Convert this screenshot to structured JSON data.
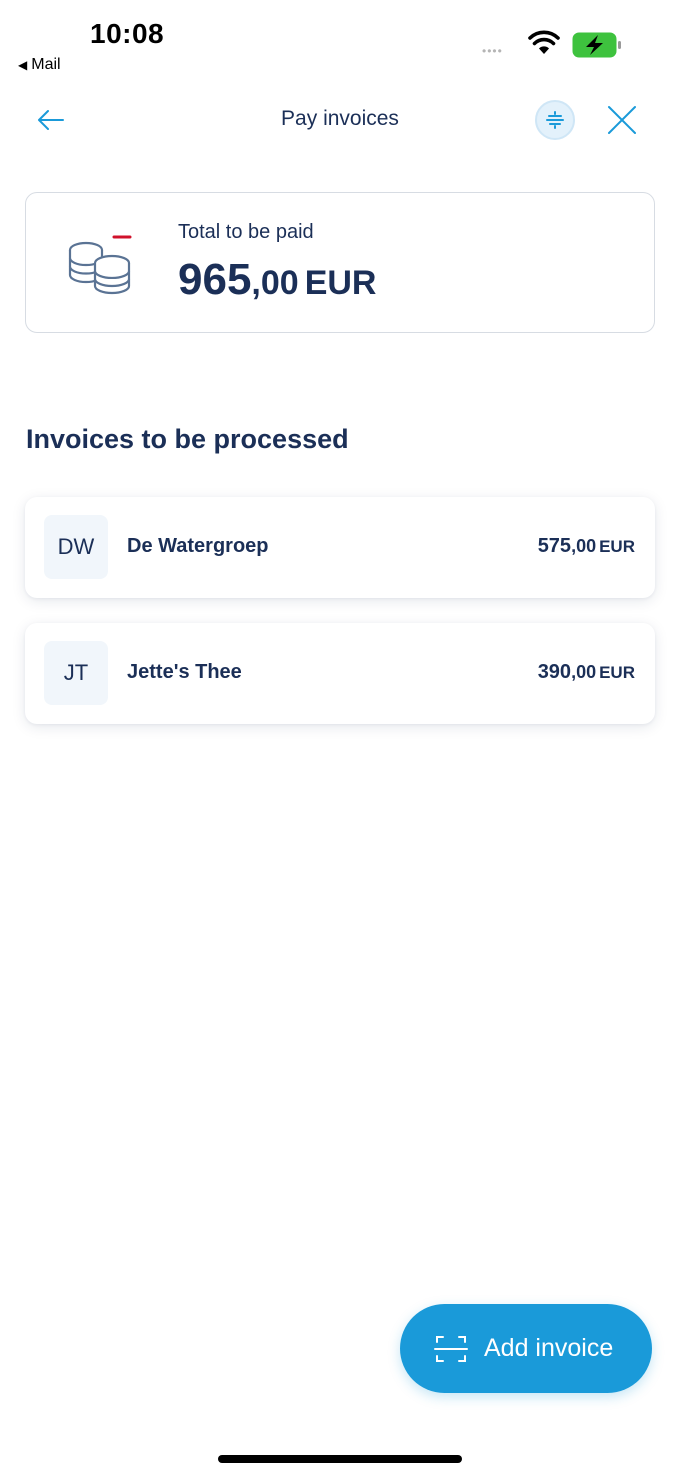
{
  "status_bar": {
    "time": "10:08",
    "back_app": "Mail",
    "back_glyph": "◀",
    "signal": "••••",
    "wifi_icon": "wifi-icon",
    "battery_icon": "battery-charging-icon"
  },
  "nav": {
    "title": "Pay invoices",
    "back_icon": "arrow-left-icon",
    "filter_icon": "filter-icon",
    "close_icon": "close-icon"
  },
  "total": {
    "label": "Total to be paid",
    "amount_int": "965",
    "amount_dec": ",00",
    "currency": "EUR",
    "icon": "coins-minus-icon"
  },
  "section_title": "Invoices to be processed",
  "invoices": [
    {
      "initials": "DW",
      "name": "De Watergroep",
      "amount_int": "575",
      "amount_dec": ",00",
      "currency": "EUR"
    },
    {
      "initials": "JT",
      "name": "Jette's Thee",
      "amount_int": "390",
      "amount_dec": ",00",
      "currency": "EUR"
    }
  ],
  "fab": {
    "label": "Add invoice",
    "icon": "scan-icon"
  },
  "colors": {
    "primary_text": "#1b2f57",
    "accent": "#1a9ad9",
    "minus_red": "#d0112b",
    "battery_green": "#3ec23e"
  }
}
